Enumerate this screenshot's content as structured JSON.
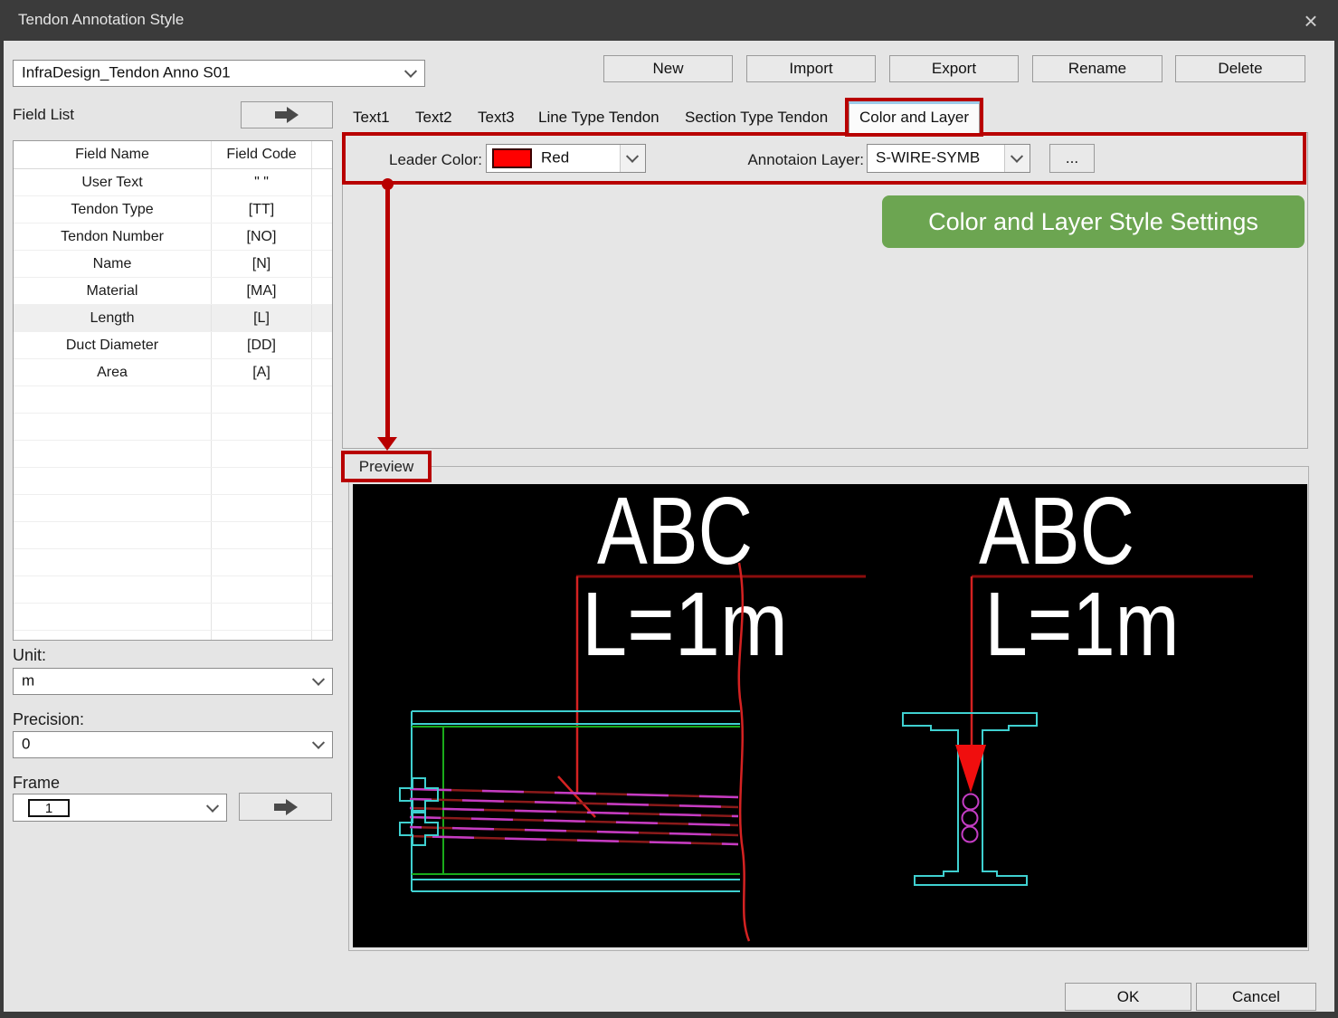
{
  "window": {
    "title": "Tendon Annotation Style",
    "close_icon": "×"
  },
  "style_selector": {
    "value": "InfraDesign_Tendon Anno S01"
  },
  "toolbar": {
    "new_label": "New",
    "import_label": "Import",
    "export_label": "Export",
    "rename_label": "Rename",
    "delete_label": "Delete"
  },
  "field_list": {
    "label": "Field List",
    "header": {
      "name": "Field Name",
      "code": "Field Code"
    },
    "rows": [
      {
        "name": "User Text",
        "code": "\" \""
      },
      {
        "name": "Tendon Type",
        "code": "[TT]"
      },
      {
        "name": "Tendon Number",
        "code": "[NO]"
      },
      {
        "name": "Name",
        "code": "[N]"
      },
      {
        "name": "Material",
        "code": "[MA]"
      },
      {
        "name": "Length",
        "code": "[L]"
      },
      {
        "name": "Duct Diameter",
        "code": "[DD]"
      },
      {
        "name": "Area",
        "code": "[A]"
      }
    ],
    "selected": "Length"
  },
  "tabs": {
    "text1": "Text1",
    "text2": "Text2",
    "text3": "Text3",
    "line_type": "Line Type Tendon",
    "section_type": "Section Type Tendon",
    "color_layer": "Color and Layer",
    "active": "Color and Layer"
  },
  "settings": {
    "leader_color_label": "Leader Color:",
    "leader_color_value": "Red",
    "leader_color_hex": "#ff0000",
    "layer_label": "Annotaion Layer:",
    "layer_value": "S-WIRE-SYMB",
    "browse_label": "..."
  },
  "callout": {
    "text": "Color and Layer Style Settings",
    "bg": "#6ca551"
  },
  "highlight": {
    "color": "#b80000"
  },
  "preview": {
    "label": "Preview",
    "line_view": {
      "title": "ABC",
      "length": "L=1m"
    },
    "section_view": {
      "title": "ABC",
      "length": "L=1m"
    }
  },
  "unit": {
    "label": "Unit:",
    "value": "m"
  },
  "precision": {
    "label": "Precision:",
    "value": "0"
  },
  "frame": {
    "label": "Frame",
    "value": "1"
  },
  "footer": {
    "ok_label": "OK",
    "cancel_label": "Cancel"
  }
}
